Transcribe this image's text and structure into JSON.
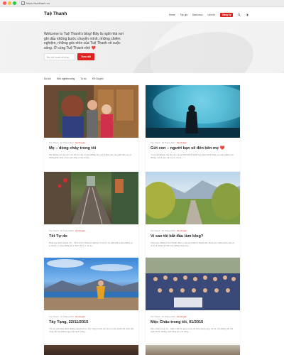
{
  "browser": {
    "url": "https://tuethanh.vn"
  },
  "header": {
    "brand": "Tuệ Thanh",
    "nav": [
      "Home",
      "Tác giả",
      "Danh mục",
      "Liên hệ"
    ],
    "cta": "Đăng ký"
  },
  "hero": {
    "text": "Welcome to Tuệ Thanh's blog! Đây là ngôi nhà nơi ghi dấu những bước chuyển mình, những chiêm nghiệm, những góc nhìn của Tuệ Thanh về cuộc sống. Ở cùng Tuệ Thanh nhé",
    "heart": "❤️",
    "email_placeholder": "Địa chỉ email của bạn",
    "subscribe": "Theo dõi"
  },
  "tags": [
    "Du lịch",
    "Kinh nghiệm sống",
    "Tự do",
    "Kể Chuyện"
  ],
  "posts": [
    {
      "author": "Tuệ Thanh",
      "date": "22 Tháng 2017",
      "tag": "Kể Chuyện",
      "title": "Mẹ – dòng chảy trong tôi",
      "excerpt": "Mẹ thương tôi của tôi! Con lớn rồi, mẹ có nhớ những lần con đi khỏi nhà, mẹ ngồi đợi con về, những đêm mưa to bao giờ cũng có mẹ ở bên…"
    },
    {
      "author": "Tuệ Thanh",
      "date": "15 Tháng 2017",
      "tag": "Kể Chuyện",
      "title": "Gửi con – người bạn sẽ đến bên mẹ",
      "heart": "❤️",
      "excerpt": "\"Con biết không, cha mẹ của con sẽ mãi mãi là người bạn đồng hành cùng con trên những con đường con đi qua, dù con có rời xa…\""
    },
    {
      "author": "Tuệ Thanh",
      "date": "20 Tháng 2016",
      "tag": "Kể Chuyện",
      "title": "Tết Tự do",
      "excerpt": "Hôm nay Quốc khánh 2/9 – Tết Tự do! Chúng ta nghĩ gì về tự do? Có phải khi ta làm những gì ta muốn, ta sống những gì ta thích thì ta có tự do…"
    },
    {
      "author": "Tuệ Thanh",
      "date": "20 Tháng 2016",
      "tag": "Kể Chuyện",
      "title": "Vì sao tôi bắt đầu làm blog?",
      "excerpt": "Chào bạn, Mình là Tuệ Thanh. Bạn có thể gọi mình là Thanh nhé. Hôm nay mình muốn chia sẻ về lý do mình bắt đầu viết những dòng này…"
    },
    {
      "author": "Tuệ Thanh",
      "date": "21 Tháng 2015",
      "tag": "Kể Chuyện",
      "title": "Tây Tạng, 22/11/2015",
      "excerpt": "Tôi bao giờ cũng thích những chuyến đi xa. Tây Tạng là một nơi mà tôi luôn muốn đặt chân đến, vùng đất của những ngọn núi tuyết trắng…"
    },
    {
      "author": "Tuệ Thanh",
      "date": "01 Tháng 2015",
      "tag": "Kể Chuyện",
      "title": "Mộc Châu trong tôi, 01/2015",
      "excerpt": "Mộc Châu trong tôi… Mộc Châu là một nơi mà tôi luôn muốn quay trở lại, với những đồi chè xanh mướt, những cánh đồng hoa cải trắng…"
    }
  ]
}
